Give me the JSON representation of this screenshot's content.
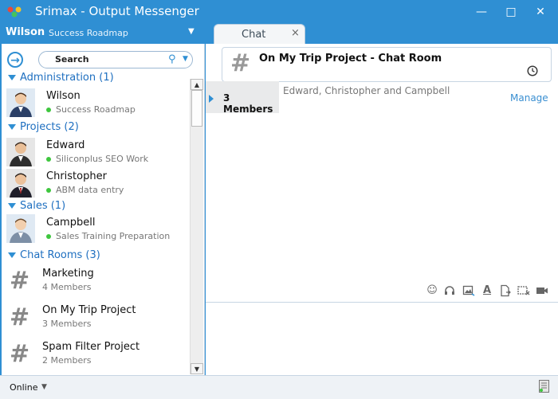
{
  "window": {
    "title": "Srimax - Output Messenger"
  },
  "user": {
    "name": "Wilson",
    "status": "Success Roadmap"
  },
  "tabs": [
    {
      "label": "Chat",
      "close": "×"
    }
  ],
  "search": {
    "value": "Search"
  },
  "groups": [
    {
      "header": "Administration (1)",
      "contacts": [
        {
          "name": "Wilson",
          "status": "Success Roadmap"
        }
      ]
    },
    {
      "header": "Projects (2)",
      "contacts": [
        {
          "name": "Edward",
          "status": "Siliconplus SEO Work"
        },
        {
          "name": "Christopher",
          "status": "ABM data entry"
        }
      ]
    },
    {
      "header": "Sales (1)",
      "contacts": [
        {
          "name": "Campbell",
          "status": "Sales Training Preparation"
        }
      ]
    },
    {
      "header": "Chat Rooms (3)",
      "rooms": [
        {
          "name": "Marketing",
          "members": "4 Members"
        },
        {
          "name": "On My Trip Project",
          "members": "3 Members"
        },
        {
          "name": "Spam Filter Project",
          "members": "2 Members"
        }
      ]
    }
  ],
  "chat": {
    "room_title": "On My Trip Project - Chat Room",
    "members_label": "3 Members",
    "members_names": "Edward, Christopher and Campbell",
    "manage_label": "Manage"
  },
  "toolbar_icons": [
    "emoji-icon",
    "headset-icon",
    "image-icon",
    "font-icon",
    "file-send-icon",
    "screen-capture-icon",
    "video-icon"
  ],
  "statusbar": {
    "status": "Online"
  },
  "colors": {
    "accent": "#2f8fd3",
    "group_header": "#1e6fc0",
    "online": "#3ec63e"
  }
}
